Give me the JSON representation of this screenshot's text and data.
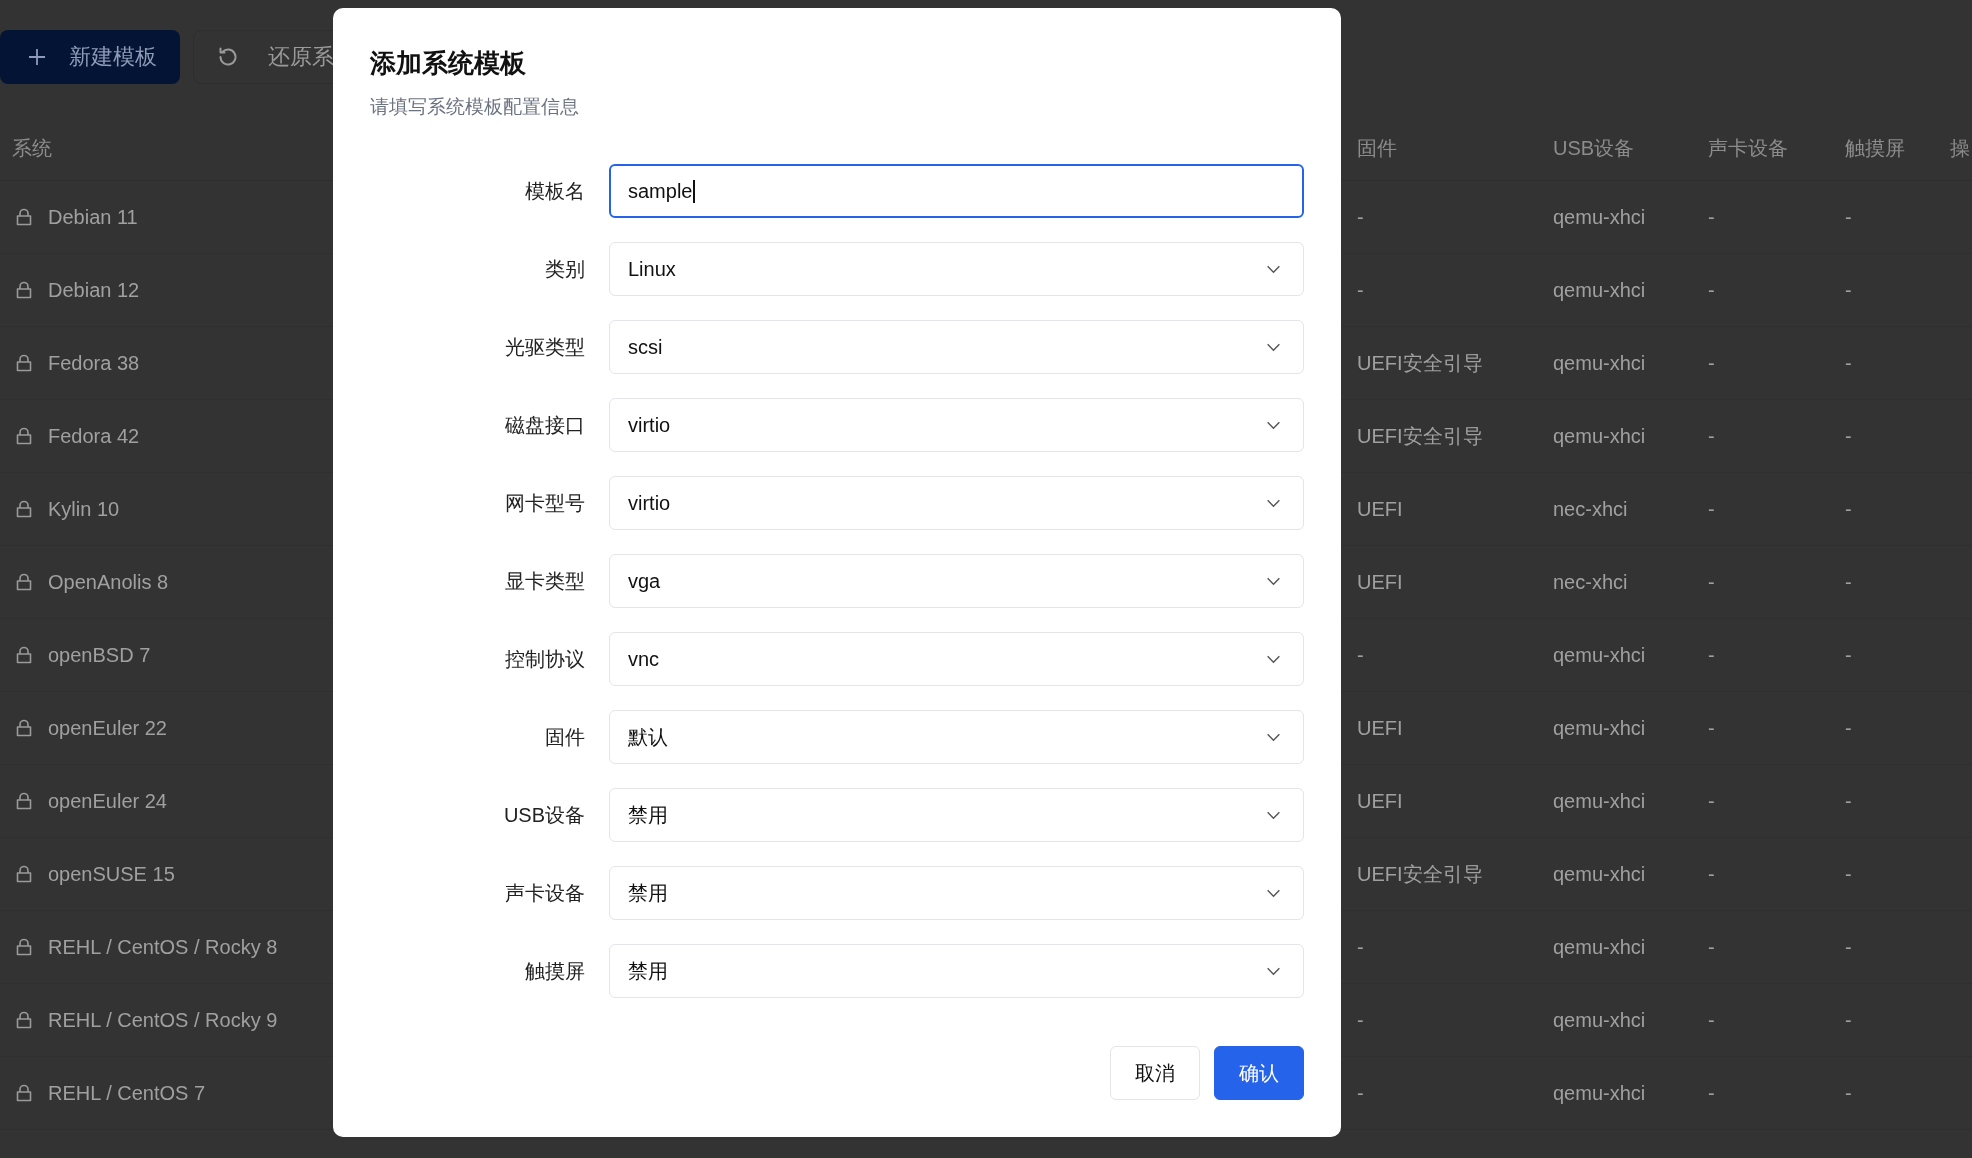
{
  "toolbar": {
    "buttons": [
      {
        "label": "新建模板",
        "kind": "primary"
      },
      {
        "label": "还原系",
        "kind": "restore"
      }
    ]
  },
  "table": {
    "columns": [
      {
        "label": "系统",
        "kind": "system"
      },
      {
        "label": "固件",
        "kind": "firmware"
      },
      {
        "label": "USB设备",
        "kind": "usb"
      },
      {
        "label": "声卡设备",
        "kind": "sound"
      },
      {
        "label": "触摸屏",
        "kind": "touch"
      },
      {
        "label": "操",
        "kind": "ops"
      }
    ],
    "rows": [
      {
        "system": "Debian 11",
        "firmware": "-",
        "usb": "qemu-xhci",
        "sound": "-",
        "touch": "-"
      },
      {
        "system": "Debian 12",
        "firmware": "-",
        "usb": "qemu-xhci",
        "sound": "-",
        "touch": "-"
      },
      {
        "system": "Fedora 38",
        "firmware": "UEFI安全引导",
        "usb": "qemu-xhci",
        "sound": "-",
        "touch": "-"
      },
      {
        "system": "Fedora 42",
        "firmware": "UEFI安全引导",
        "usb": "qemu-xhci",
        "sound": "-",
        "touch": "-"
      },
      {
        "system": "Kylin 10",
        "firmware": "UEFI",
        "usb": "nec-xhci",
        "sound": "-",
        "touch": "-"
      },
      {
        "system": "OpenAnolis 8",
        "firmware": "UEFI",
        "usb": "nec-xhci",
        "sound": "-",
        "touch": "-"
      },
      {
        "system": "openBSD 7",
        "firmware": "-",
        "usb": "qemu-xhci",
        "sound": "-",
        "touch": "-"
      },
      {
        "system": "openEuler 22",
        "firmware": "UEFI",
        "usb": "qemu-xhci",
        "sound": "-",
        "touch": "-"
      },
      {
        "system": "openEuler 24",
        "firmware": "UEFI",
        "usb": "qemu-xhci",
        "sound": "-",
        "touch": "-"
      },
      {
        "system": "openSUSE 15",
        "firmware": "UEFI安全引导",
        "usb": "qemu-xhci",
        "sound": "-",
        "touch": "-"
      },
      {
        "system": "REHL / CentOS / Rocky 8",
        "firmware": "-",
        "usb": "qemu-xhci",
        "sound": "-",
        "touch": "-"
      },
      {
        "system": "REHL / CentOS / Rocky 9",
        "firmware": "-",
        "usb": "qemu-xhci",
        "sound": "-",
        "touch": "-"
      },
      {
        "system": "REHL / CentOS 7",
        "firmware": "-",
        "usb": "qemu-xhci",
        "sound": "-",
        "touch": "-"
      }
    ]
  },
  "dialog": {
    "title": "添加系统模板",
    "subtitle": "请填写系统模板配置信息",
    "fields": [
      {
        "label": "模板名",
        "value": "sample",
        "kind": "text",
        "focused": true
      },
      {
        "label": "类别",
        "value": "Linux",
        "kind": "select",
        "focused": false
      },
      {
        "label": "光驱类型",
        "value": "scsi",
        "kind": "select",
        "focused": false
      },
      {
        "label": "磁盘接口",
        "value": "virtio",
        "kind": "select",
        "focused": false
      },
      {
        "label": "网卡型号",
        "value": "virtio",
        "kind": "select",
        "focused": false
      },
      {
        "label": "显卡类型",
        "value": "vga",
        "kind": "select",
        "focused": false
      },
      {
        "label": "控制协议",
        "value": "vnc",
        "kind": "select",
        "focused": false
      },
      {
        "label": "固件",
        "value": "默认",
        "kind": "select",
        "focused": false
      },
      {
        "label": "USB设备",
        "value": "禁用",
        "kind": "select",
        "focused": false
      },
      {
        "label": "声卡设备",
        "value": "禁用",
        "kind": "select",
        "focused": false
      },
      {
        "label": "触摸屏",
        "value": "禁用",
        "kind": "select",
        "focused": false
      }
    ],
    "buttons": [
      {
        "label": "取消",
        "kind": "secondary"
      },
      {
        "label": "确认",
        "kind": "primary"
      }
    ]
  }
}
